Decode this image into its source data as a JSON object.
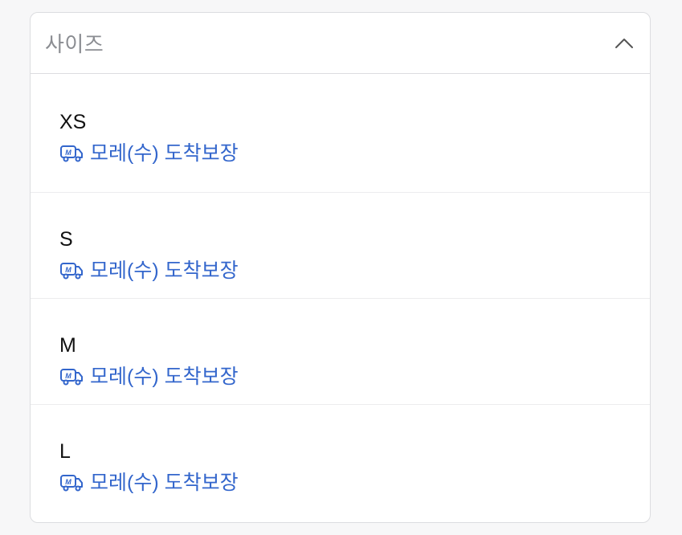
{
  "dropdown": {
    "placeholder": "사이즈",
    "expanded": true,
    "chevron_icon": "chevron-up-icon",
    "accent_color": "#3366cc",
    "options": [
      {
        "name": "XS",
        "delivery_label": "모레(수) 도착보장",
        "icon": "truck-icon"
      },
      {
        "name": "S",
        "delivery_label": "모레(수) 도착보장",
        "icon": "truck-icon"
      },
      {
        "name": "M",
        "delivery_label": "모레(수) 도착보장",
        "icon": "truck-icon"
      },
      {
        "name": "L",
        "delivery_label": "모레(수) 도착보장",
        "icon": "truck-icon"
      }
    ]
  }
}
